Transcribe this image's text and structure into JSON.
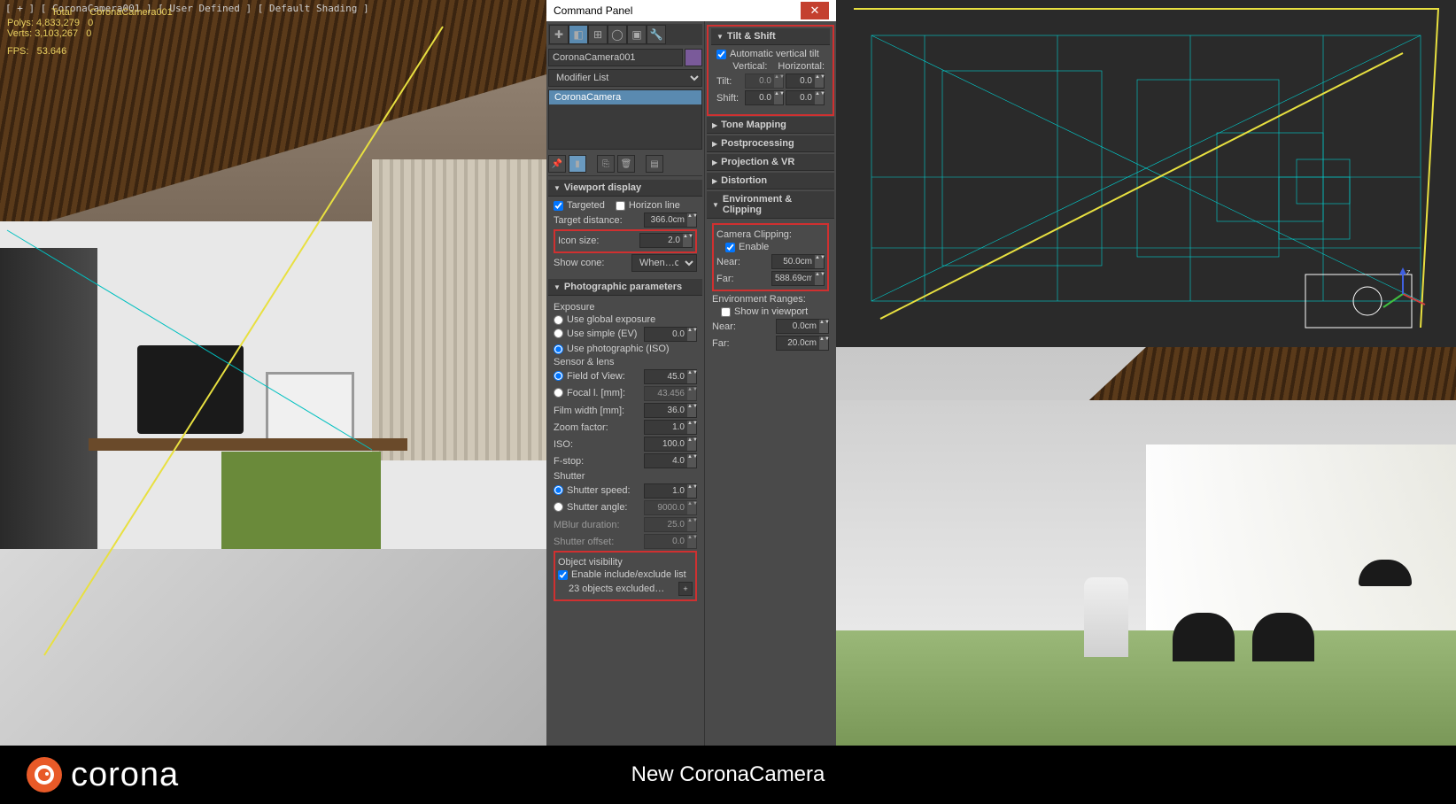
{
  "viewport_label": "[ + ] [ CoronaCamera001 ] [ User Defined ] [ Default Shading ]",
  "stats": {
    "header_total": "Total",
    "header_cam": "CoronaCamera001",
    "polys_label": "Polys:",
    "polys_total": "4,833,279",
    "polys_cam": "0",
    "verts_label": "Verts:",
    "verts_total": "3,103,267",
    "verts_cam": "0",
    "fps_label": "FPS:",
    "fps_value": "53.646"
  },
  "panel": {
    "title": "Command Panel",
    "object_name": "CoronaCamera001",
    "modifier_list_label": "Modifier List",
    "modifier_item": "CoronaCamera"
  },
  "viewport_display": {
    "title": "Viewport display",
    "targeted": "Targeted",
    "horizon": "Horizon line",
    "target_distance_label": "Target distance:",
    "target_distance": "366.0cm",
    "icon_size_label": "Icon size:",
    "icon_size": "2.0",
    "show_cone_label": "Show cone:",
    "show_cone": "When…cted"
  },
  "photo": {
    "title": "Photographic parameters",
    "exposure_label": "Exposure",
    "use_global": "Use global exposure",
    "use_simple": "Use simple (EV)",
    "simple_val": "0.0",
    "use_photo": "Use photographic (ISO)",
    "sensor_label": "Sensor & lens",
    "fov_label": "Field of View:",
    "fov": "45.0",
    "focal_label": "Focal l. [mm]:",
    "focal": "43.456",
    "film_label": "Film width [mm]:",
    "film": "36.0",
    "zoom_label": "Zoom factor:",
    "zoom": "1.0",
    "iso_label": "ISO:",
    "iso": "100.0",
    "fstop_label": "F-stop:",
    "fstop": "4.0",
    "shutter_label": "Shutter",
    "shutter_speed_label": "Shutter speed:",
    "shutter_speed": "1.0",
    "shutter_angle_label": "Shutter angle:",
    "shutter_angle": "9000.0",
    "mblur_label": "MBlur duration:",
    "mblur": "25.0",
    "shutter_offset_label": "Shutter offset:",
    "shutter_offset": "0.0",
    "visibility_label": "Object visibility",
    "enable_list": "Enable include/exclude list",
    "excluded_count": "23 objects excluded…"
  },
  "tilt": {
    "title": "Tilt & Shift",
    "auto": "Automatic vertical tilt",
    "vertical": "Vertical:",
    "horizontal": "Horizontal:",
    "tilt_label": "Tilt:",
    "tilt_v": "0.0",
    "tilt_h": "0.0",
    "shift_label": "Shift:",
    "shift_v": "0.0",
    "shift_h": "0.0"
  },
  "rollouts": {
    "tone_mapping": "Tone Mapping",
    "postprocessing": "Postprocessing",
    "projection": "Projection & VR",
    "distortion": "Distortion"
  },
  "env": {
    "title": "Environment & Clipping",
    "clipping_label": "Camera Clipping:",
    "enable": "Enable",
    "near_label": "Near:",
    "near": "50.0cm",
    "far_label": "Far:",
    "far": "588.69cm",
    "ranges_label": "Environment Ranges:",
    "show_viewport": "Show in viewport",
    "env_near_label": "Near:",
    "env_near": "0.0cm",
    "env_far_label": "Far:",
    "env_far": "20.0cm"
  },
  "footer": {
    "brand": "corona",
    "title": "New CoronaCamera"
  }
}
